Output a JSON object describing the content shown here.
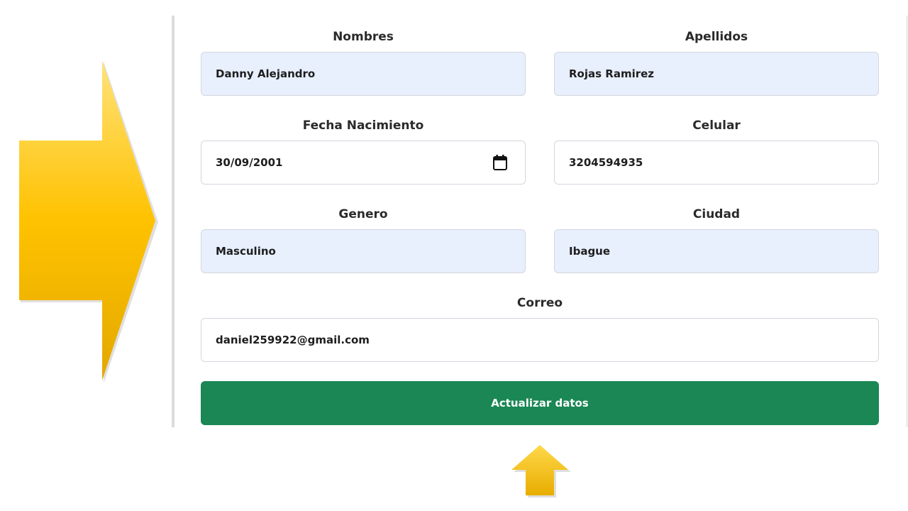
{
  "form": {
    "nombres": {
      "label": "Nombres",
      "value": "Danny Alejandro"
    },
    "apellidos": {
      "label": "Apellidos",
      "value": "Rojas Ramirez"
    },
    "fecha_nacimiento": {
      "label": "Fecha Nacimiento",
      "value": "30/09/2001"
    },
    "celular": {
      "label": "Celular",
      "value": "3204594935"
    },
    "genero": {
      "label": "Genero",
      "value": "Masculino"
    },
    "ciudad": {
      "label": "Ciudad",
      "value": "Ibague"
    },
    "correo": {
      "label": "Correo",
      "value": "daniel259922@gmail.com"
    },
    "submit_label": "Actualizar datos"
  },
  "icons": {
    "date_picker": "calendar-icon",
    "annotations": [
      "arrow-right-icon",
      "arrow-up-icon"
    ]
  },
  "colors": {
    "button": "#1a8754",
    "autofill_field": "#e8effd",
    "arrow_gold": "#ffc20e"
  }
}
